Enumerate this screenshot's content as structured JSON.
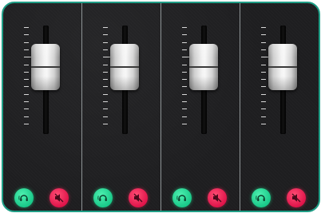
{
  "mixer": {
    "frame_color": "#1f9e86",
    "channels": [
      {
        "fader_level": 0.62
      },
      {
        "fader_level": 0.62
      },
      {
        "fader_level": 0.62
      },
      {
        "fader_level": 0.62
      }
    ],
    "listen_icon": "headphones-icon",
    "mute_icon": "speaker-muted-icon",
    "listen_color": "#1fd08f",
    "mute_color": "#ef1f55"
  }
}
